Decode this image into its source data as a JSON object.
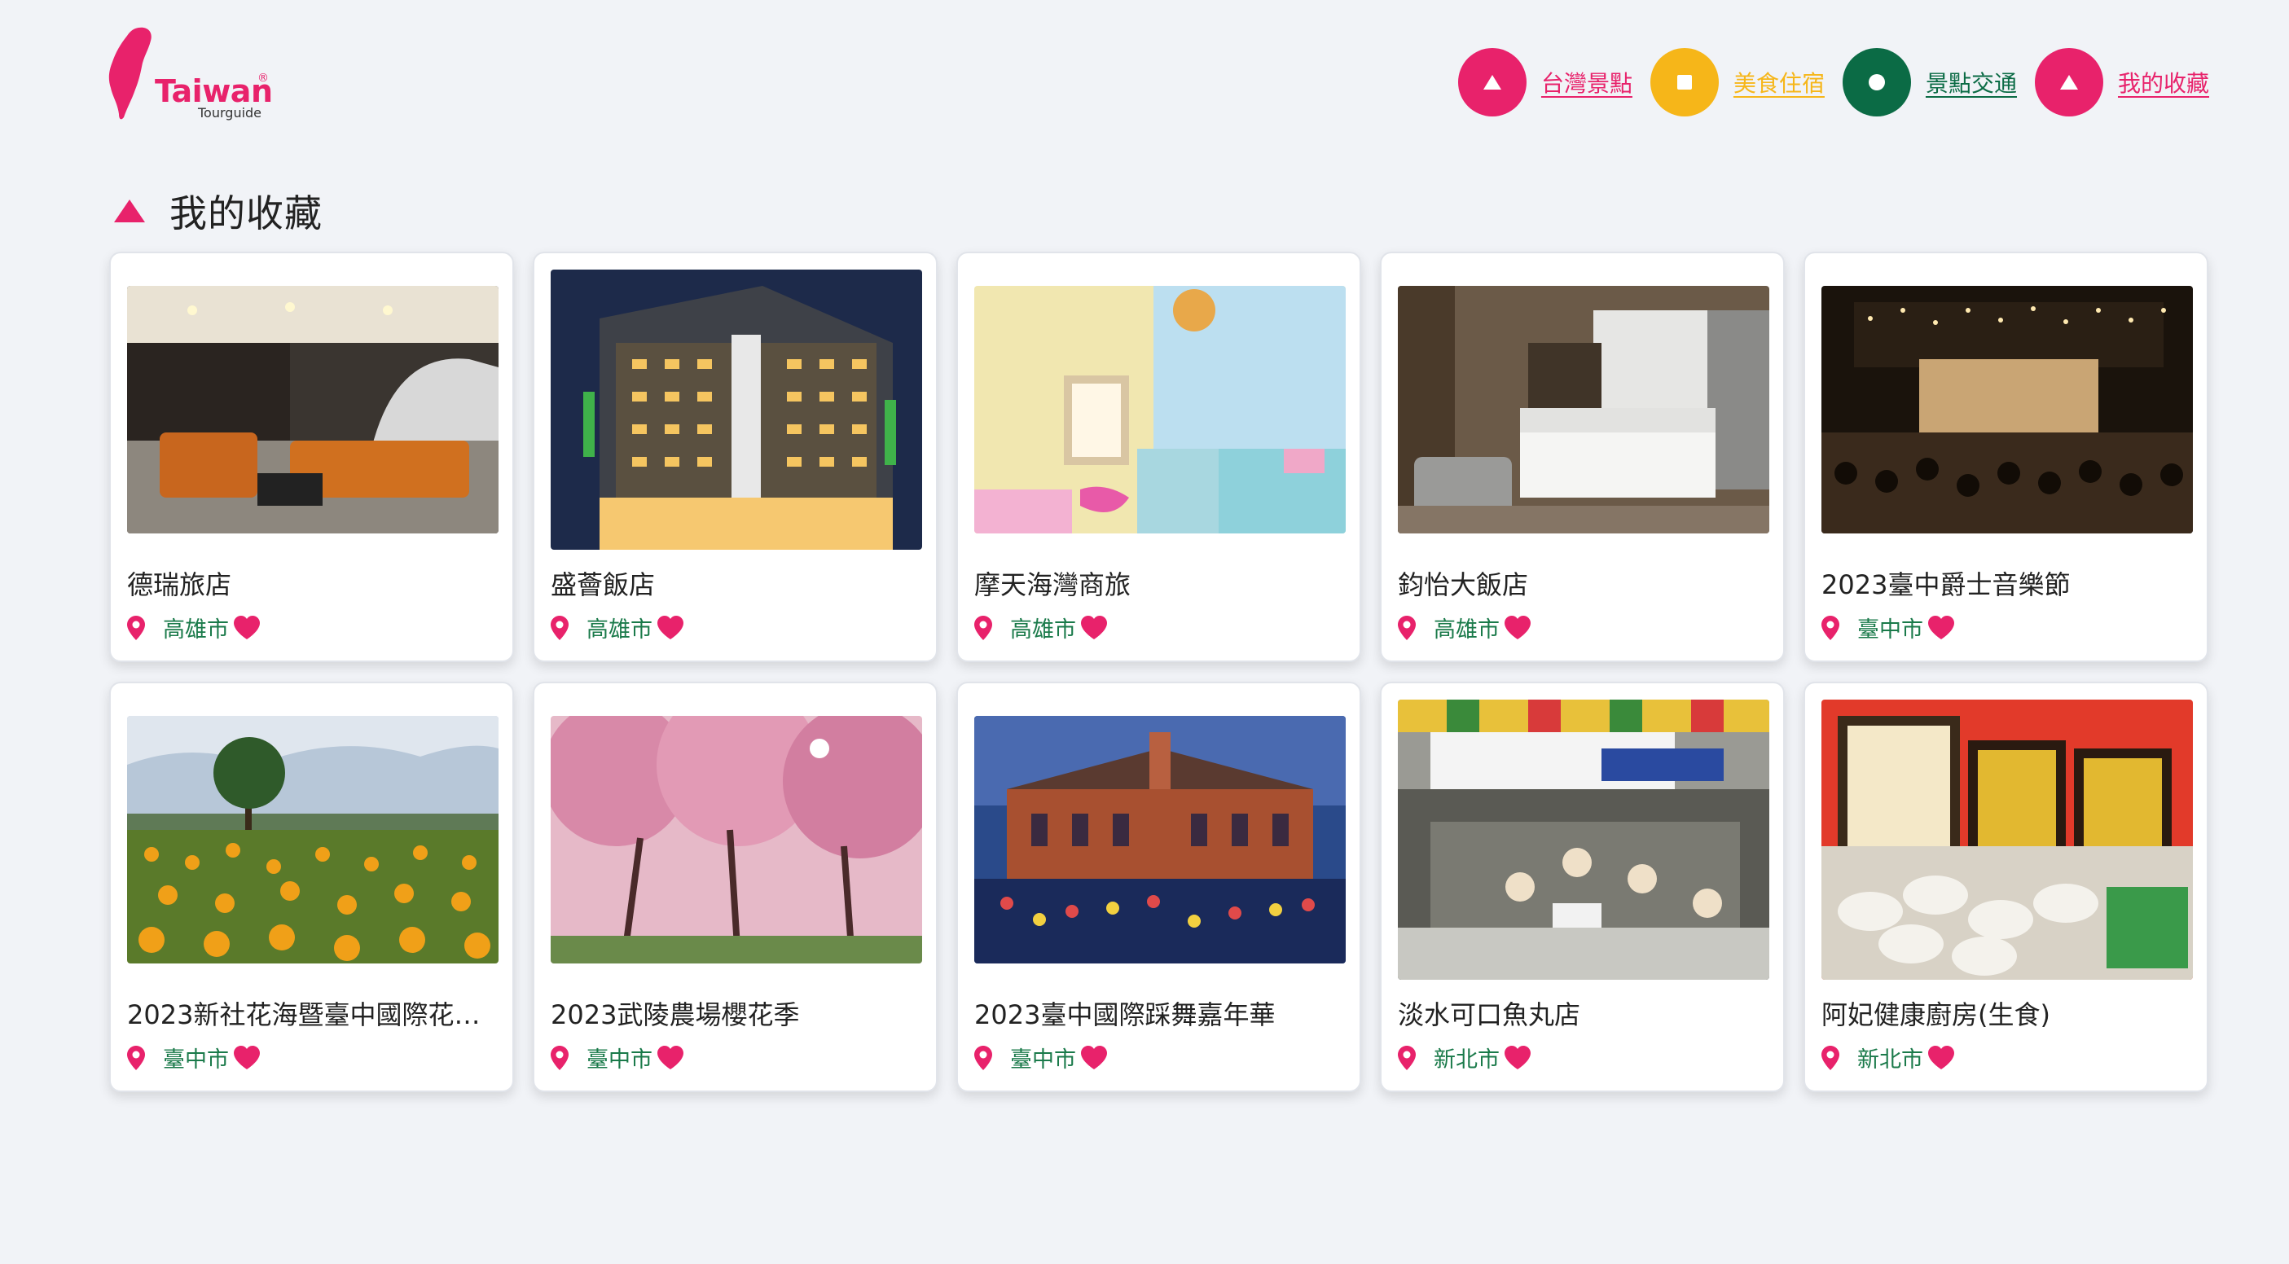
{
  "brand": {
    "name": "Taiwan",
    "mark": "®",
    "sub": "Tourguide",
    "color": "#e8226b"
  },
  "nav": [
    {
      "label": "台灣景點",
      "shape": "triangle",
      "color": "#e8226b",
      "icon": "triangle-icon"
    },
    {
      "label": "美食住宿",
      "shape": "square",
      "color": "#f6b619",
      "icon": "square-icon"
    },
    {
      "label": "景點交通",
      "shape": "circle",
      "color": "#0b6b45",
      "icon": "circle-icon"
    },
    {
      "label": "我的收藏",
      "shape": "triangle",
      "color": "#e8226b",
      "icon": "triangle-icon"
    }
  ],
  "section": {
    "title": "我的收藏"
  },
  "favorites": [
    {
      "title": "德瑞旅店",
      "city": "高雄市",
      "image": "hotel-lobby-photo"
    },
    {
      "title": "盛薈飯店",
      "city": "高雄市",
      "image": "hotel-exterior-night-photo"
    },
    {
      "title": "摩天海灣商旅",
      "city": "高雄市",
      "image": "hotel-room-pastel-photo"
    },
    {
      "title": "鈞怡大飯店",
      "city": "高雄市",
      "image": "hotel-room-modern-photo"
    },
    {
      "title": "2023臺中爵士音樂節",
      "city": "臺中市",
      "image": "jazz-festival-stage-photo"
    },
    {
      "title": "2023新社花海暨臺中國際花毯...",
      "city": "臺中市",
      "image": "flower-field-photo"
    },
    {
      "title": "2023武陵農場櫻花季",
      "city": "臺中市",
      "image": "cherry-blossom-photo"
    },
    {
      "title": "2023臺中國際踩舞嘉年華",
      "city": "臺中市",
      "image": "dance-carnival-photo"
    },
    {
      "title": "淡水可口魚丸店",
      "city": "新北市",
      "image": "fishball-shop-photo"
    },
    {
      "title": "阿妃健康廚房(生食)",
      "city": "新北市",
      "image": "dumplings-photo"
    }
  ],
  "colors": {
    "pin": "#e8226b",
    "heart": "#e8226b",
    "city": "#1a7a4a"
  }
}
